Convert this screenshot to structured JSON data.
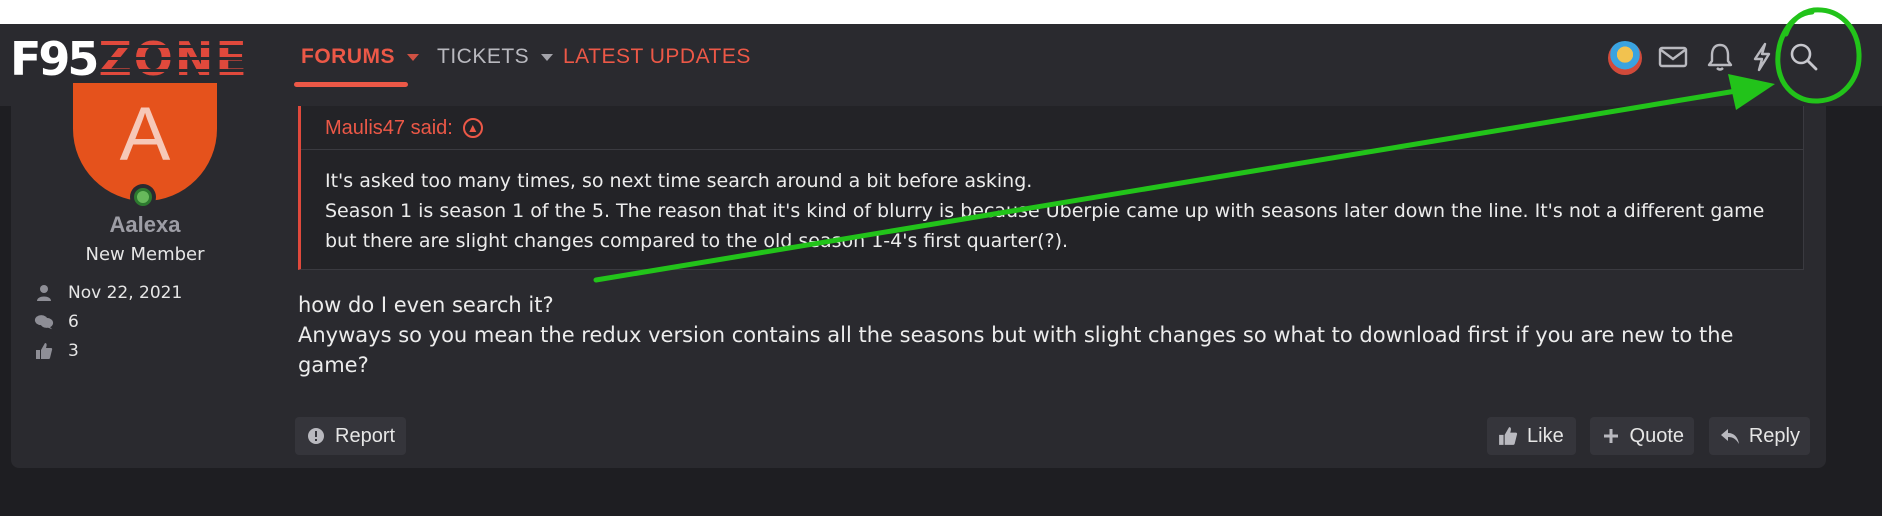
{
  "brand": {
    "logo_left": "F95",
    "logo_right": "ZONE"
  },
  "nav": {
    "tabs": [
      {
        "label": "FORUMS",
        "active": true,
        "has_dropdown": true
      },
      {
        "label": "TICKETS",
        "active": false,
        "has_dropdown": true
      },
      {
        "label": "LATEST UPDATES",
        "active": false,
        "has_dropdown": false
      }
    ],
    "icons": [
      "avatar",
      "envelope-icon",
      "bell-icon",
      "bolt-icon",
      "search-icon"
    ]
  },
  "user": {
    "avatar_letter": "A",
    "name": "Aalexa",
    "title": "New Member",
    "online": true,
    "joined": "Nov 22, 2021",
    "messages": "6",
    "reactions": "3"
  },
  "quote": {
    "author": "Maulis47 said:",
    "lines": [
      "It's asked too many times, so next time search around a bit before asking.",
      "Season 1 is season 1 of the 5. The reason that it's kind of blurry is because Uberpie came up with seasons later down the line. It's not a different game but there are slight changes compared to the old season 1-4's first quarter(?)."
    ]
  },
  "message": {
    "lines": [
      "how do I even search it?",
      "Anyways so you mean the redux version contains all the seasons but with slight changes so what to download first if you are new to the game?"
    ]
  },
  "actions": {
    "report": "Report",
    "like": "Like",
    "quote": "Quote",
    "reply": "Reply"
  },
  "colors": {
    "accent": "#ec5847",
    "avatar_bg": "#e5521c",
    "annotation": "#22c31a",
    "panel": "#2a2a2f",
    "page_bg": "#1e1e22"
  }
}
